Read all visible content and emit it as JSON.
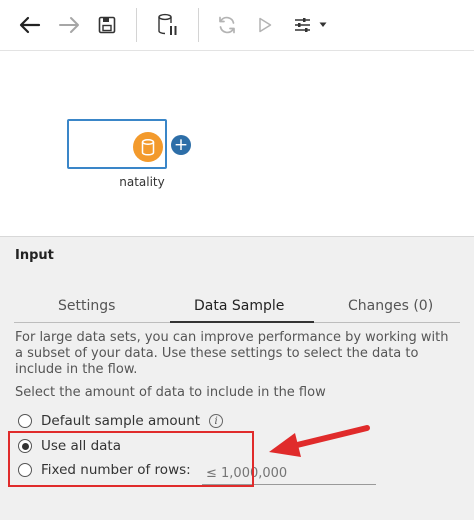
{
  "toolbar": {
    "items": [
      {
        "icon": "back-arrow-icon"
      },
      {
        "icon": "forward-arrow-icon"
      },
      {
        "icon": "save-icon"
      },
      {
        "icon": "pause-data-updates-icon"
      },
      {
        "icon": "refresh-icon"
      },
      {
        "icon": "run-icon"
      },
      {
        "icon": "settings-sliders-icon"
      }
    ]
  },
  "flow": {
    "node": {
      "label": "natality",
      "icon": "database-icon",
      "accent_color": "#f39a2c",
      "border_color": "#3a86c8"
    },
    "add_step_icon": "plus-icon"
  },
  "panel": {
    "title": "Input",
    "tabs": [
      {
        "label": "Settings",
        "active": false
      },
      {
        "label": "Data Sample",
        "active": true
      },
      {
        "label": "Changes (0)",
        "active": false
      }
    ],
    "description": "For large data sets, you can improve performance by working with a subset of your data. Use these settings to select the data to include in the flow.",
    "select_label": "Select the amount of data to include in the flow",
    "options": [
      {
        "label": "Default sample amount",
        "selected": false,
        "info_icon": "info-icon"
      },
      {
        "label": "Use all data",
        "selected": true
      },
      {
        "label": "Fixed number of rows:",
        "selected": false
      }
    ],
    "rows_input": {
      "value": "",
      "placeholder": "≤ 1,000,000"
    }
  },
  "annotation": {
    "color": "#e02b2b"
  }
}
